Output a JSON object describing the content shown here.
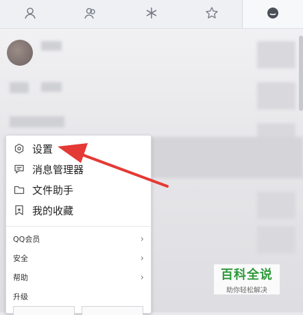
{
  "tabs": [
    {
      "name": "contact-icon",
      "active": false
    },
    {
      "name": "group-icon",
      "active": false
    },
    {
      "name": "snowflake-icon",
      "active": false
    },
    {
      "name": "star-icon",
      "active": false
    },
    {
      "name": "message-icon",
      "active": true
    }
  ],
  "menu": {
    "primary": [
      {
        "label": "设置",
        "icon": "settings-hex-icon"
      },
      {
        "label": "消息管理器",
        "icon": "message-manager-icon"
      },
      {
        "label": "文件助手",
        "icon": "folder-icon"
      },
      {
        "label": "我的收藏",
        "icon": "bookmark-icon"
      }
    ],
    "secondary": [
      {
        "label": "QQ会员"
      },
      {
        "label": "安全"
      },
      {
        "label": "帮助"
      },
      {
        "label": "升级"
      }
    ]
  },
  "watermark": {
    "title": "百科全说",
    "subtitle": "助你轻松解决"
  },
  "colors": {
    "arrow": "#e53935",
    "watermark_green": "#2c9a3a"
  }
}
